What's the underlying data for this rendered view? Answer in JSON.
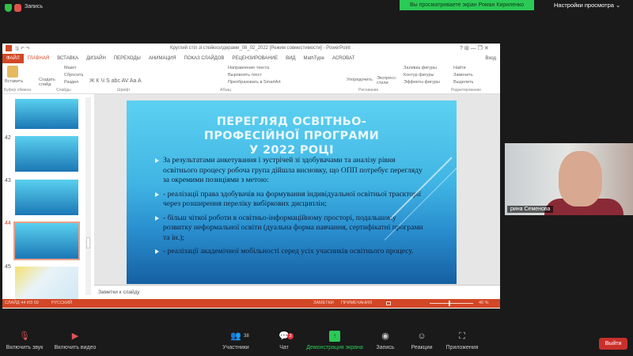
{
  "zoom_top": {
    "recording_label": "Запись",
    "share_banner": "Вы просматриваете экран Роман Кириленко",
    "view_options": "Настройки просмотра ⌄"
  },
  "ppt": {
    "window_title": "Круглий стіл зі стейкхолдерами_08_02_2022 [Режим совместимости] - PowerPoint",
    "window_controls": "?  ⊞  —  ❐  ✕",
    "user": "Вход",
    "tabs": [
      "ФАЙЛ",
      "ГЛАВНАЯ",
      "ВСТАВКА",
      "ДИЗАЙН",
      "ПЕРЕХОДЫ",
      "АНИМАЦИЯ",
      "ПОКАЗ СЛАЙДОВ",
      "РЕЦЕНЗИРОВАНИЕ",
      "ВИД",
      "MathType",
      "ACROBAT"
    ],
    "ribbon": {
      "paste": "Вставить",
      "new_slide": "Создать слайд",
      "layout": "Макет",
      "reset": "Сбросить",
      "section": "Раздел",
      "font_buttons": "Ж  К  Ч  S  abc  AV  Aa  A",
      "text_direction": "Направление текста",
      "align_text": "Выровнять текст",
      "smartart": "Преобразовать в SmartArt",
      "arrange": "Упорядочить",
      "quick_styles": "Экспресс-стили",
      "shape_fill": "Заливка фигуры",
      "shape_outline": "Контур фигуры",
      "shape_effects": "Эффекты фигуры",
      "find": "Найти",
      "replace": "Заменить",
      "select": "Выделить"
    },
    "groups": [
      "Буфер обмена",
      "Слайды",
      "Шрифт",
      "Абзац",
      "Рисование",
      "Редактирование"
    ],
    "thumbnails": [
      {
        "num": ""
      },
      {
        "num": "42"
      },
      {
        "num": "43"
      },
      {
        "num": "44"
      },
      {
        "num": "45"
      }
    ],
    "slide": {
      "title": "ПЕРЕГЛЯД ОСВІТНЬО-ПРОФЕСІЙНОЇ ПРОГРАМИ У 2022 РОЦІ",
      "bullets": [
        "За результатами анкетування і зустрічей зі здобувачами та аналізу рівня освітнього процесу робоча група дійшла висновку, що ОПП потребує перегляду за окремими позиціями з метою:",
        "- реалізації права здобувачів на формування індивідуальної освітньої траєкторії через розширення переліку вибіркових дисциплін;",
        "- більш чіткої роботи в освітньо-інформаційному просторі, подальшому розвитку неформальної освіти (дуальна форма навчання, сертифікатні програми та ін.);",
        "- реалізації академічної мобільності серед усіх учасників освітнього процесу."
      ]
    },
    "notes_placeholder": "Заметки к слайду",
    "status": {
      "slide_counter": "СЛАЙД 44 ИЗ 59",
      "language": "РУССКИЙ",
      "notes": "ЗАМЕТКИ",
      "comments": "ПРИМЕЧАНИЯ",
      "zoom": "46 %"
    }
  },
  "video": {
    "participant_name": "рина Семенова"
  },
  "toolbar": {
    "unmute": "Включить звук",
    "start_video": "Включить видео",
    "participants": "Участники",
    "participants_count": "38",
    "chat": "Чат",
    "chat_badge": "3",
    "share": "Демонстрация экрана",
    "record": "Запись",
    "reactions": "Реакции",
    "apps": "Приложения",
    "leave": "Выйти"
  },
  "colors": {
    "ppt_accent": "#d24726",
    "zoom_green": "#2bc956",
    "leave_red": "#c9302c"
  }
}
